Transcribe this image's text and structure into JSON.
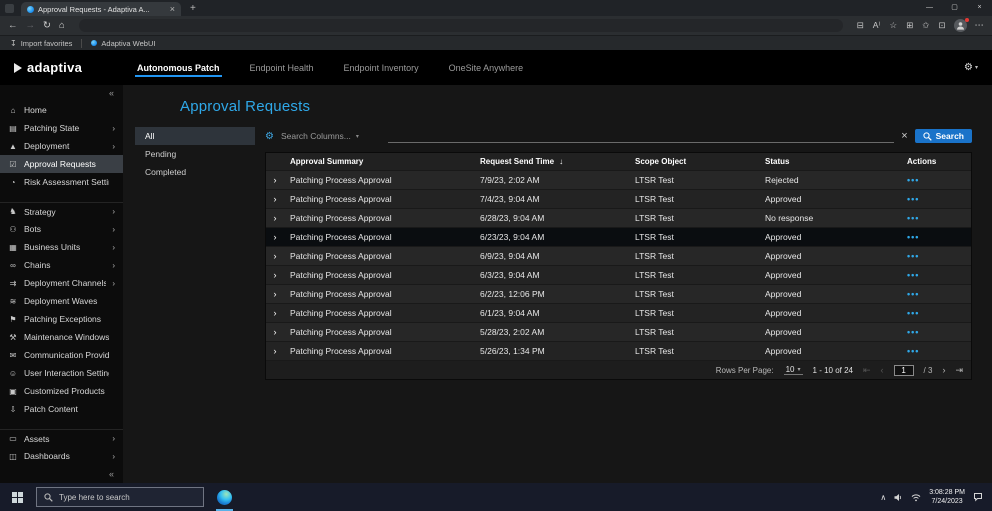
{
  "colors": {
    "accent_blue": "#2196f3",
    "title_blue": "#2fa8e8",
    "action_blue": "#2fa8e8",
    "rejected_row_accent": "#272727"
  },
  "browser": {
    "tab": {
      "title": "Approval Requests - Adaptiva A...",
      "close_glyph": "×"
    },
    "new_tab_glyph": "+",
    "window_controls": {
      "minimize": "—",
      "maximize": "▢",
      "close": "×"
    },
    "toolbar": {
      "back_glyph": "←",
      "forward_glyph": "→",
      "refresh_glyph": "↻",
      "home_glyph": "⌂",
      "icons": [
        {
          "name": "split-screen-icon",
          "glyph": "⊟"
        },
        {
          "name": "read-aloud-icon",
          "glyph": "A⁾"
        },
        {
          "name": "favorites-icon",
          "glyph": "☆"
        },
        {
          "name": "collections-icon",
          "glyph": "⊞"
        },
        {
          "name": "favorites-bar-icon",
          "glyph": "✩"
        },
        {
          "name": "extensions-icon",
          "glyph": "⊡"
        }
      ],
      "menu_glyph": "⋯"
    },
    "favorites_bar": {
      "import_glyph": "↧",
      "import_label": "Import favorites",
      "bookmark_label": "Adaptiva WebUI"
    }
  },
  "app": {
    "logo_text": "adaptiva",
    "nav": [
      {
        "label": "Autonomous Patch",
        "active": true
      },
      {
        "label": "Endpoint Health",
        "active": false
      },
      {
        "label": "Endpoint Inventory",
        "active": false
      },
      {
        "label": "OneSite Anywhere",
        "active": false
      }
    ],
    "settings_glyph": "⚙",
    "settings_caret_glyph": "▾"
  },
  "sidebar": {
    "collapse_glyph": "«",
    "expand_glyph": "›",
    "items": [
      {
        "label": "Home",
        "icon": "home-icon",
        "glyph": "⌂"
      },
      {
        "label": "Patching State",
        "icon": "patching-state-icon",
        "glyph": "▤",
        "expandable": true
      },
      {
        "label": "Deployment",
        "icon": "deployment-icon",
        "glyph": "▲",
        "expandable": true
      },
      {
        "label": "Approval Requests",
        "icon": "approval-requests-icon",
        "glyph": "☑",
        "active": true
      },
      {
        "label": "Risk Assessment Settings",
        "icon": "risk-assessment-icon",
        "glyph": "◔"
      },
      {
        "label": "Strategy",
        "icon": "strategy-icon",
        "glyph": "♞",
        "expandable": true,
        "section_start": true
      },
      {
        "label": "Bots",
        "icon": "bots-icon",
        "glyph": "⚇",
        "expandable": true
      },
      {
        "label": "Business Units",
        "icon": "business-units-icon",
        "glyph": "▦",
        "expandable": true
      },
      {
        "label": "Chains",
        "icon": "chains-icon",
        "glyph": "∞",
        "expandable": true
      },
      {
        "label": "Deployment Channels",
        "icon": "deployment-channels-icon",
        "glyph": "⇉",
        "expandable": true
      },
      {
        "label": "Deployment Waves",
        "icon": "deployment-waves-icon",
        "glyph": "≋"
      },
      {
        "label": "Patching Exceptions",
        "icon": "patching-exceptions-icon",
        "glyph": "⚑"
      },
      {
        "label": "Maintenance Windows",
        "icon": "maintenance-windows-icon",
        "glyph": "⚒"
      },
      {
        "label": "Communication Providers",
        "icon": "communication-providers-icon",
        "glyph": "✉"
      },
      {
        "label": "User Interaction Settings",
        "icon": "user-interaction-settings-icon",
        "glyph": "☺"
      },
      {
        "label": "Customized Products",
        "icon": "customized-products-icon",
        "glyph": "▣"
      },
      {
        "label": "Patch Content",
        "icon": "patch-content-icon",
        "glyph": "⇩"
      },
      {
        "label": "Assets",
        "icon": "assets-icon",
        "glyph": "▭",
        "expandable": true,
        "section_start": true
      },
      {
        "label": "Dashboards",
        "icon": "dashboards-icon",
        "glyph": "◫",
        "expandable": true
      }
    ]
  },
  "main": {
    "title": "Approval Requests",
    "filter_tabs": [
      {
        "label": "All",
        "active": true
      },
      {
        "label": "Pending",
        "active": false
      },
      {
        "label": "Completed",
        "active": false
      }
    ],
    "search": {
      "gear_glyph": "⚙",
      "columns_label": "Search Columns...",
      "caret_glyph": "▾",
      "clear_glyph": "×",
      "button_label": "Search"
    },
    "table": {
      "columns": [
        "Approval Summary",
        "Request Send Time",
        "Scope Object",
        "Status",
        "Actions"
      ],
      "sort_glyph": "↓",
      "expand_glyph": "›",
      "actions_glyph": "•••",
      "rows": [
        {
          "summary": "Patching Process Approval",
          "time": "7/9/23, 2:02 AM",
          "scope": "LTSR Test",
          "status": "Rejected"
        },
        {
          "summary": "Patching Process Approval",
          "time": "7/4/23, 9:04 AM",
          "scope": "LTSR Test",
          "status": "Approved"
        },
        {
          "summary": "Patching Process Approval",
          "time": "6/28/23, 9:04 AM",
          "scope": "LTSR Test",
          "status": "No response"
        },
        {
          "summary": "Patching Process Approval",
          "time": "6/23/23, 9:04 AM",
          "scope": "LTSR Test",
          "status": "Approved",
          "selected": true
        },
        {
          "summary": "Patching Process Approval",
          "time": "6/9/23, 9:04 AM",
          "scope": "LTSR Test",
          "status": "Approved"
        },
        {
          "summary": "Patching Process Approval",
          "time": "6/3/23, 9:04 AM",
          "scope": "LTSR Test",
          "status": "Approved"
        },
        {
          "summary": "Patching Process Approval",
          "time": "6/2/23, 12:06 PM",
          "scope": "LTSR Test",
          "status": "Approved"
        },
        {
          "summary": "Patching Process Approval",
          "time": "6/1/23, 9:04 AM",
          "scope": "LTSR Test",
          "status": "Approved"
        },
        {
          "summary": "Patching Process Approval",
          "time": "5/28/23, 2:02 AM",
          "scope": "LTSR Test",
          "status": "Approved"
        },
        {
          "summary": "Patching Process Approval",
          "time": "5/26/23, 1:34 PM",
          "scope": "LTSR Test",
          "status": "Approved"
        }
      ]
    },
    "pagination": {
      "rows_per_page_label": "Rows Per Page:",
      "rows_per_page_value": "10",
      "rows_per_page_caret": "▾",
      "range_text": "1 - 10 of 24",
      "first_glyph": "⇤",
      "prev_glyph": "‹",
      "next_glyph": "›",
      "last_glyph": "⇥",
      "page_value": "1",
      "page_total": "/ 3"
    }
  },
  "taskbar": {
    "search_placeholder": "Type here to search",
    "hidden_icons_glyph": "∧",
    "clock_time": "3:08:28 PM",
    "clock_date": "7/24/2023"
  }
}
